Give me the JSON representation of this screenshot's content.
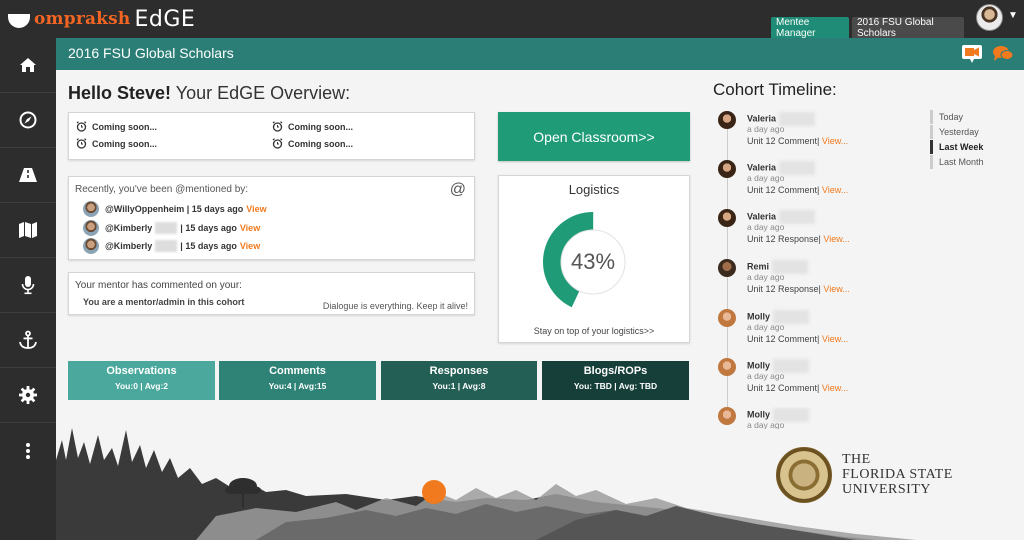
{
  "app": {
    "brand_part1": "ompraksh",
    "brand_part2": "EdGE"
  },
  "tabs": [
    {
      "label": "Mentee Manager"
    },
    {
      "label": "2016 FSU Global Scholars"
    }
  ],
  "header": {
    "title": "2016 FSU Global Scholars"
  },
  "greeting": {
    "hello": "Hello Steve!",
    "rest": " Your EdGE Overview:"
  },
  "coming_soon": {
    "label": "Coming soon..."
  },
  "mentions": {
    "heading": "Recently, you've been @mentioned by:",
    "at": "@",
    "items": [
      {
        "user": "@WillyOppenheim",
        "ago": "| 15 days ago",
        "view": "View"
      },
      {
        "user": "@Kimberly",
        "ago": "| 15 days ago",
        "view": "View"
      },
      {
        "user": "@Kimberly",
        "ago": "| 15 days ago",
        "view": "View"
      }
    ]
  },
  "mentor": {
    "heading": "Your mentor has commented on your:",
    "sub": "You are a mentor/admin in this cohort",
    "note": "Dialogue is everything. Keep it alive!"
  },
  "classroom": {
    "label": "Open Classroom>>"
  },
  "logistics": {
    "title": "Logistics",
    "percent": 43,
    "percent_label": "43%",
    "footer": "Stay on top of your logistics>>"
  },
  "stats": [
    {
      "label": "Observations",
      "values": "You:0 | Avg:2",
      "color": "#4aa89c"
    },
    {
      "label": "Comments",
      "values": "You:4 | Avg:15",
      "color": "#2f8276"
    },
    {
      "label": "Responses",
      "values": "You:1 | Avg:8",
      "color": "#245f56"
    },
    {
      "label": "Blogs/ROPs",
      "values": "You: TBD | Avg: TBD",
      "color": "#173f3a"
    }
  ],
  "timeline": {
    "title": "Cohort Timeline:",
    "entries": [
      {
        "name": "Valeria",
        "time": "a day ago",
        "desc": "Unit 12 Comment|",
        "view": "View..."
      },
      {
        "name": "Valeria",
        "time": "a day ago",
        "desc": "Unit 12 Comment|",
        "view": "View..."
      },
      {
        "name": "Valeria",
        "time": "a day ago",
        "desc": "Unit 12 Response|",
        "view": "View..."
      },
      {
        "name": "Remi",
        "time": "a day ago",
        "desc": "Unit 12 Response|",
        "view": "View..."
      },
      {
        "name": "Molly",
        "time": "a day ago",
        "desc": "Unit 12 Comment|",
        "view": "View..."
      },
      {
        "name": "Molly",
        "time": "a day ago",
        "desc": "Unit 12 Comment|",
        "view": "View..."
      },
      {
        "name": "Molly",
        "time": "a day ago",
        "desc": "",
        "view": ""
      }
    ],
    "filters": [
      "Today",
      "Yesterday",
      "Last Week",
      "Last Month"
    ],
    "active_filter": "Last Week"
  },
  "university": {
    "line1": "THE",
    "line2": "FLORIDA STATE",
    "line3": "UNIVERSITY"
  },
  "colors": {
    "accent": "#2a7e75",
    "orange": "#f27a1e",
    "green_button": "#1f9c77",
    "sidebar": "#2d2d2d"
  },
  "icons": {
    "sidebar": [
      "home-icon",
      "compass-icon",
      "road-icon",
      "map-icon",
      "microphone-icon",
      "anchor-icon",
      "gear-icon",
      "more-vertical-icon"
    ],
    "header": [
      "video-camera-icon",
      "chat-bubbles-icon"
    ]
  }
}
